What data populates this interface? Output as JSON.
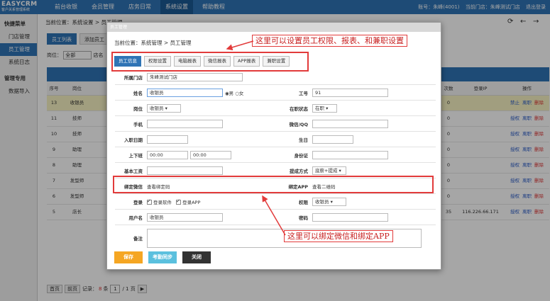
{
  "topbar": {
    "logo_main": "EASYCRM",
    "logo_sub": "客户关系管理系统",
    "nav": [
      "前台收银",
      "会员管理",
      "店务日常",
      "系统设置",
      "帮助教程"
    ],
    "active_nav": 3,
    "account": "账号：朱峰(4001)",
    "store": "当前门店：朱峰测试门店",
    "logout": "退出登录"
  },
  "sidebar": {
    "quick_title": "快捷菜单",
    "items": [
      "门店管理",
      "员工管理",
      "系统日志"
    ],
    "admin_title": "管理专用",
    "admin_items": [
      "数据导入"
    ]
  },
  "page": {
    "breadcrumb": "当前位置：系统设置 > 员工管理",
    "tab_list": "员工列表",
    "tab_add": "添加员工",
    "filter_label": "岗位：",
    "filter_value": "全部",
    "filter_label2": "店名",
    "toolbar_icons": [
      "refresh-icon",
      "back-icon",
      "forward-icon"
    ],
    "table_headers": {
      "no": "序号",
      "position": "岗位",
      "count": "次数",
      "ip": "登录IP",
      "ops": "操作"
    },
    "rows": [
      {
        "no": "13",
        "position": "收银员",
        "count": "0",
        "ip": "",
        "ops": [
          "禁止",
          "离职",
          "删除"
        ]
      },
      {
        "no": "11",
        "position": "技师",
        "count": "0",
        "ip": "",
        "ops": [
          "授权",
          "离职",
          "删除"
        ]
      },
      {
        "no": "10",
        "position": "技师",
        "count": "0",
        "ip": "",
        "ops": [
          "授权",
          "离职",
          "删除"
        ]
      },
      {
        "no": "9",
        "position": "助理",
        "count": "0",
        "ip": "",
        "ops": [
          "授权",
          "离职",
          "删除"
        ]
      },
      {
        "no": "8",
        "position": "助理",
        "count": "0",
        "ip": "",
        "ops": [
          "授权",
          "离职",
          "删除"
        ]
      },
      {
        "no": "7",
        "position": "发型师",
        "count": "0",
        "ip": "",
        "ops": [
          "授权",
          "离职",
          "删除"
        ]
      },
      {
        "no": "6",
        "position": "发型师",
        "count": "0",
        "ip": "",
        "ops": [
          "授权",
          "离职",
          "删除"
        ]
      },
      {
        "no": "5",
        "position": "店长",
        "count": "35",
        "ip": "116.226.66.171",
        "ops": [
          "授权",
          "离职",
          "删除"
        ]
      }
    ],
    "pager": {
      "first": "首页",
      "prev": "前页",
      "records_label": "记录：",
      "records": "8",
      "records_unit": "条",
      "page": "1",
      "total": "/ 1 页"
    }
  },
  "modal": {
    "title": "员工管理",
    "breadcrumb": "当前位置：系统管理 > 员工管理",
    "tabs": [
      "员工信息",
      "权限设置",
      "电脑报表",
      "微信报表",
      "APP报表",
      "兼职设置"
    ],
    "form": {
      "store_label": "所属门店",
      "store": "朱峰测试门店",
      "name_label": "姓名",
      "name": "收银员",
      "gender_male": "男",
      "gender_female": "女",
      "code_label": "工号",
      "code": "91",
      "position_label": "岗位",
      "position": "收银员",
      "status_label": "在职状态",
      "status": "在职",
      "phone_label": "手机",
      "phone": "",
      "wechat_label": "微信/QQ",
      "wechat": "",
      "join_label": "入职日期",
      "join": "",
      "birthday_label": "生日",
      "birthday": "",
      "shift_label": "上下班",
      "shift_start": "00:00",
      "shift_end": "00:00",
      "idcard_label": "身份证",
      "idcard": "",
      "salary_label": "基本工资",
      "salary": "",
      "commission_label": "提成方式",
      "commission": "底薪+提成",
      "bind_wechat_label": "绑定微信",
      "bind_wechat": "查看绑定码",
      "bind_app_label": "绑定APP",
      "bind_app": "查看二维码",
      "login_label": "登录",
      "login_soft": "登录软件",
      "login_app": "登录APP",
      "perm_label": "权限",
      "perm": "收银员",
      "user_label": "用户名",
      "user": "收银员",
      "pwd_label": "密码",
      "pwd": "",
      "remark_label": "备注",
      "remark": ""
    },
    "buttons": {
      "save": "保存",
      "sync": "考勤同步",
      "close": "关闭"
    }
  },
  "annotations": {
    "top": "这里可以设置员工权限、报表、和兼职设置",
    "bottom": "这里可以绑定微信和绑定APP"
  },
  "colors": {
    "brand": "#2f74b5",
    "annotation": "#e23b3b",
    "save": "#f5a623",
    "sync": "#5bc0de",
    "close": "#333333",
    "highlight_row": "#f7f3c3"
  }
}
